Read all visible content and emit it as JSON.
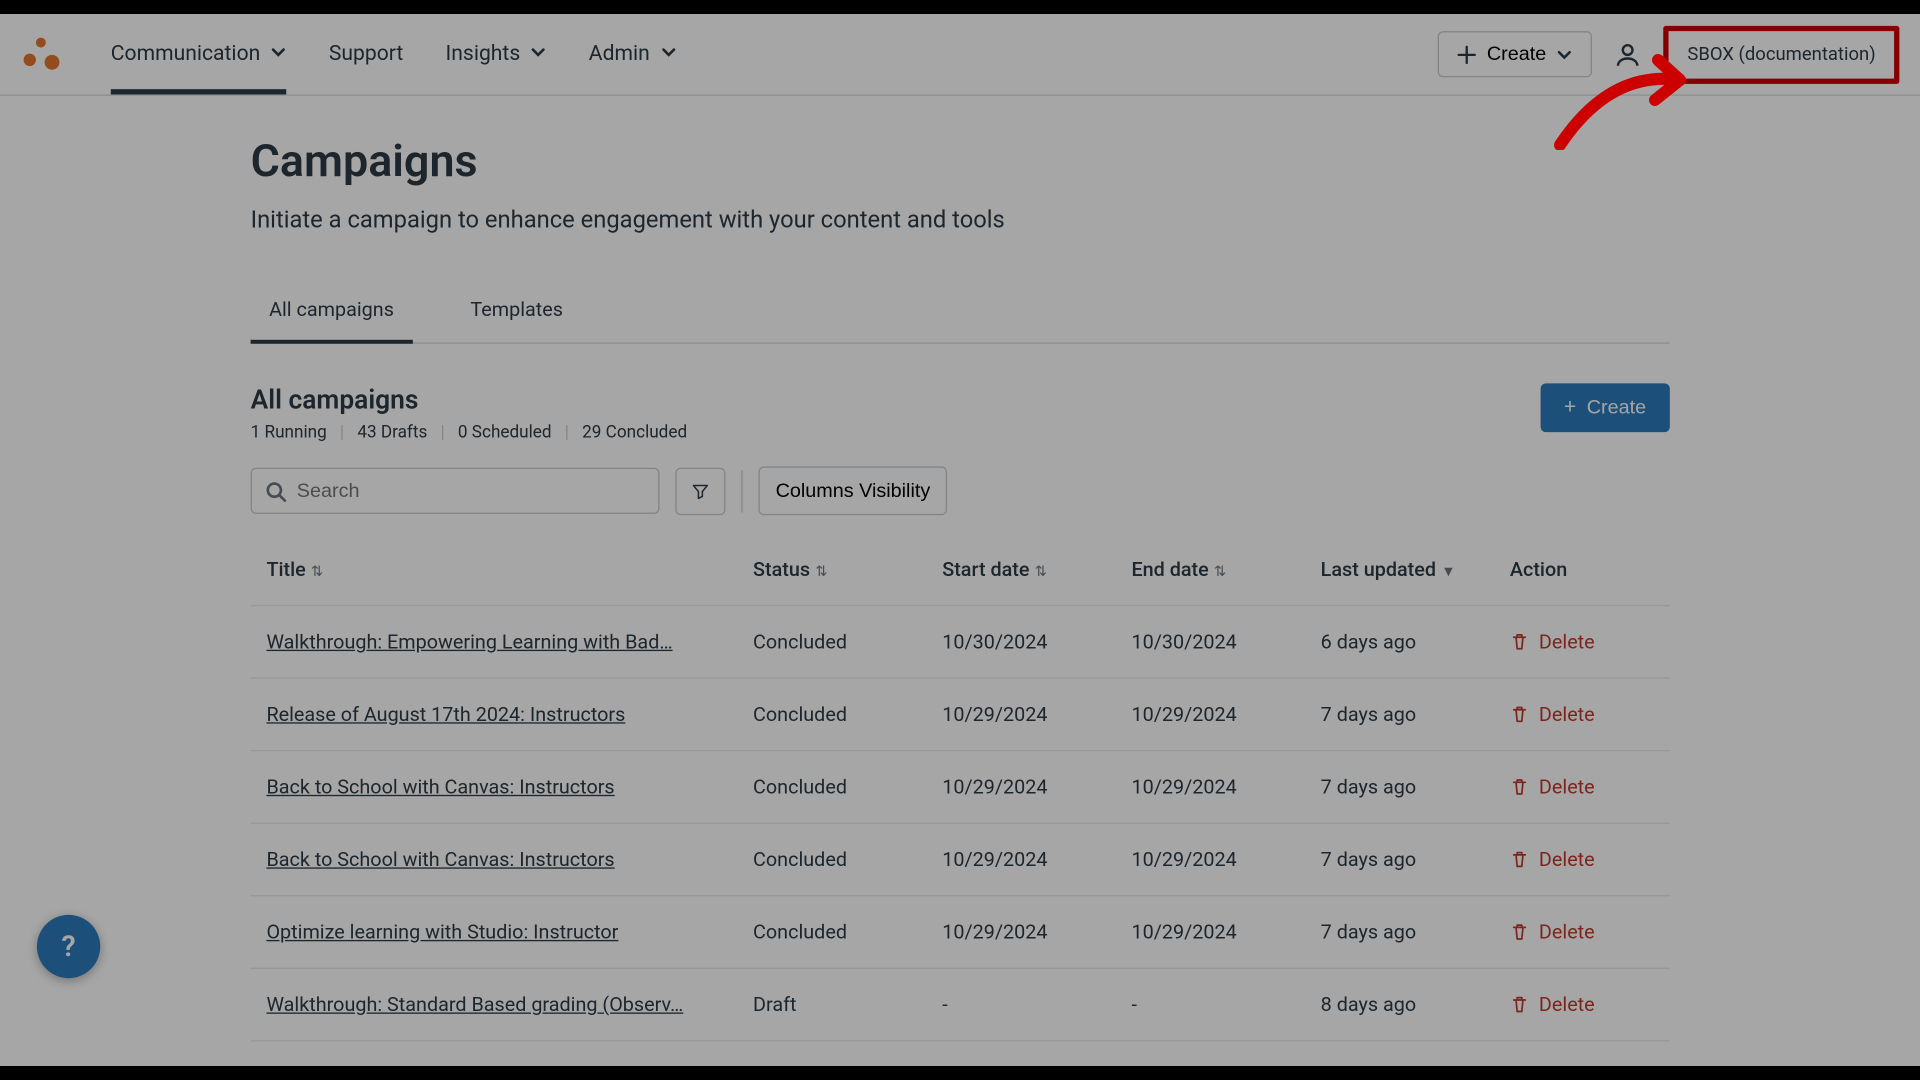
{
  "nav": {
    "items": [
      {
        "label": "Communication",
        "hasMenu": true,
        "active": true
      },
      {
        "label": "Support",
        "hasMenu": false,
        "active": false
      },
      {
        "label": "Insights",
        "hasMenu": true,
        "active": false
      },
      {
        "label": "Admin",
        "hasMenu": true,
        "active": false
      }
    ]
  },
  "topbar": {
    "create_label": "Create",
    "sbox_label": "SBOX (documentation)"
  },
  "page": {
    "title": "Campaigns",
    "subtitle": "Initiate a campaign to enhance engagement with your content and tools"
  },
  "tabs": [
    {
      "label": "All campaigns",
      "active": true
    },
    {
      "label": "Templates",
      "active": false
    }
  ],
  "section": {
    "title": "All campaigns",
    "summary": [
      "1 Running",
      "43 Drafts",
      "0 Scheduled",
      "29 Concluded"
    ],
    "create_label": "Create"
  },
  "search": {
    "placeholder": "Search"
  },
  "columns_visibility_label": "Columns Visibility",
  "table": {
    "columns": [
      "Title",
      "Status",
      "Start date",
      "End date",
      "Last updated",
      "Action"
    ],
    "delete_label": "Delete",
    "rows": [
      {
        "title": "Walkthrough: Empowering Learning with Bad…",
        "status": "Concluded",
        "start": "10/30/2024",
        "end": "10/30/2024",
        "updated": "6 days ago"
      },
      {
        "title": "Release of August 17th 2024: Instructors",
        "status": "Concluded",
        "start": "10/29/2024",
        "end": "10/29/2024",
        "updated": "7 days ago"
      },
      {
        "title": "Back to School with Canvas: Instructors",
        "status": "Concluded",
        "start": "10/29/2024",
        "end": "10/29/2024",
        "updated": "7 days ago"
      },
      {
        "title": "Back to School with Canvas: Instructors",
        "status": "Concluded",
        "start": "10/29/2024",
        "end": "10/29/2024",
        "updated": "7 days ago"
      },
      {
        "title": "Optimize learning with Studio: Instructor",
        "status": "Concluded",
        "start": "10/29/2024",
        "end": "10/29/2024",
        "updated": "7 days ago"
      },
      {
        "title": "Walkthrough: Standard Based grading (Observ…",
        "status": "Draft",
        "start": "-",
        "end": "-",
        "updated": "8 days ago"
      }
    ]
  },
  "help": {
    "label": "?"
  }
}
